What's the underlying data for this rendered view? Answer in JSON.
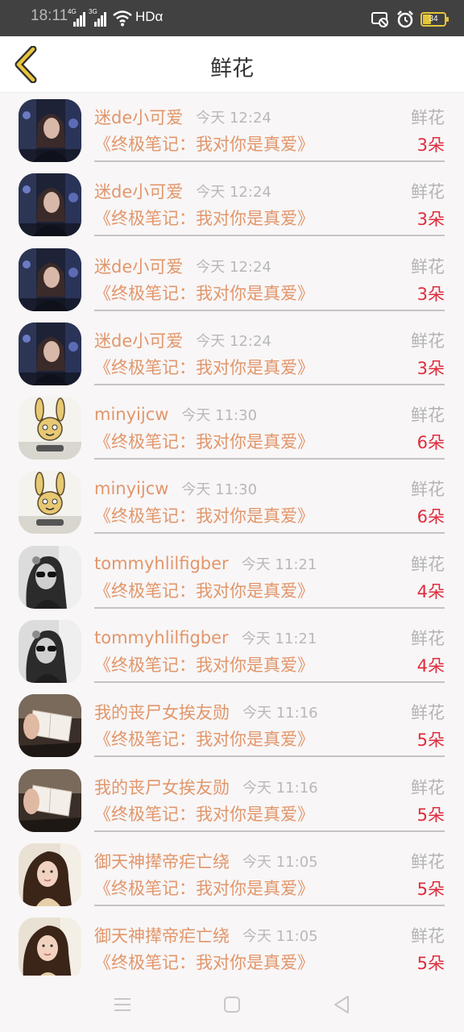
{
  "status_bar": {
    "time": "18:11",
    "signal1_label": "4G",
    "signal2_label": "3G",
    "hd_label": "HDα",
    "battery_level": "34",
    "battery_color": "#e4c53a"
  },
  "header": {
    "title": "鲜花",
    "back_icon": "chevron-left-icon",
    "accent_color": "#e8c53f"
  },
  "records": [
    {
      "name": "迷de小可爱",
      "time": "今天 12:24",
      "gift": "鲜花",
      "book": "《终极笔记：我对你是真爱》",
      "count": "3朵",
      "avatar": "concert-photo"
    },
    {
      "name": "迷de小可爱",
      "time": "今天 12:24",
      "gift": "鲜花",
      "book": "《终极笔记：我对你是真爱》",
      "count": "3朵",
      "avatar": "concert-photo"
    },
    {
      "name": "迷de小可爱",
      "time": "今天 12:24",
      "gift": "鲜花",
      "book": "《终极笔记：我对你是真爱》",
      "count": "3朵",
      "avatar": "concert-photo"
    },
    {
      "name": "迷de小可爱",
      "time": "今天 12:24",
      "gift": "鲜花",
      "book": "《终极笔记：我对你是真爱》",
      "count": "3朵",
      "avatar": "concert-photo"
    },
    {
      "name": "minyijcw",
      "time": "今天 11:30",
      "gift": "鲜花",
      "book": "《终极笔记：我对你是真爱》",
      "count": "6朵",
      "avatar": "rabbit-cartoon"
    },
    {
      "name": "minyijcw",
      "time": "今天 11:30",
      "gift": "鲜花",
      "book": "《终极笔记：我对你是真爱》",
      "count": "6朵",
      "avatar": "rabbit-cartoon"
    },
    {
      "name": "tommyhlilfigber",
      "time": "今天 11:21",
      "gift": "鲜花",
      "book": "《终极笔记：我对你是真爱》",
      "count": "4朵",
      "avatar": "bw-portrait"
    },
    {
      "name": "tommyhlilfigber",
      "time": "今天 11:21",
      "gift": "鲜花",
      "book": "《终极笔记：我对你是真爱》",
      "count": "4朵",
      "avatar": "bw-portrait"
    },
    {
      "name": "我的丧尸女挨友勋",
      "time": "今天 11:16",
      "gift": "鲜花",
      "book": "《终极笔记：我对你是真爱》",
      "count": "5朵",
      "avatar": "book-photo"
    },
    {
      "name": "我的丧尸女挨友勋",
      "time": "今天 11:16",
      "gift": "鲜花",
      "book": "《终极笔记：我对你是真爱》",
      "count": "5朵",
      "avatar": "book-photo"
    },
    {
      "name": "御天神撵帝疟亡绕",
      "time": "今天 11:05",
      "gift": "鲜花",
      "book": "《终极笔记：我对你是真爱》",
      "count": "5朵",
      "avatar": "girl-portrait"
    },
    {
      "name": "御天神撵帝疟亡绕",
      "time": "今天 11:05",
      "gift": "鲜花",
      "book": "《终极笔记：我对你是真爱》",
      "count": "5朵",
      "avatar": "girl-portrait"
    }
  ],
  "nav_bar": {
    "menu_icon": "menu-icon",
    "home_icon": "home-square-icon",
    "back_icon": "back-triangle-icon"
  }
}
